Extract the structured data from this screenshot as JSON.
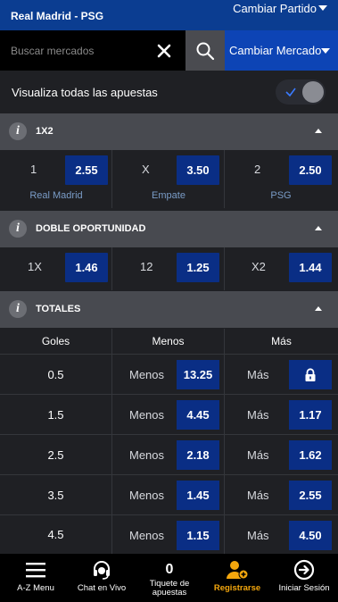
{
  "header": {
    "match_title": "Real Madrid - PSG",
    "change_match_label": "Cambiar Partido"
  },
  "search": {
    "placeholder": "Buscar mercados",
    "change_market_label": "Cambiar Mercado"
  },
  "toggle": {
    "label": "Visualiza todas las apuestas",
    "on": true
  },
  "market_1x2": {
    "title": "1X2",
    "outcomes": [
      {
        "label": "1",
        "odds": "2.55",
        "name": "Real Madrid"
      },
      {
        "label": "X",
        "odds": "3.50",
        "name": "Empate"
      },
      {
        "label": "2",
        "odds": "2.50",
        "name": "PSG"
      }
    ]
  },
  "market_double": {
    "title": "DOBLE OPORTUNIDAD",
    "outcomes": [
      {
        "label": "1X",
        "odds": "1.46"
      },
      {
        "label": "12",
        "odds": "1.25"
      },
      {
        "label": "X2",
        "odds": "1.44"
      }
    ]
  },
  "market_totals": {
    "title": "TOTALES",
    "columns": [
      "Goles",
      "Menos",
      "Más"
    ],
    "under_label": "Menos",
    "over_label": "Más",
    "rows": [
      {
        "goals": "0.5",
        "under": "13.25",
        "over": "",
        "over_locked": true
      },
      {
        "goals": "1.5",
        "under": "4.45",
        "over": "1.17"
      },
      {
        "goals": "2.5",
        "under": "2.18",
        "over": "1.62"
      },
      {
        "goals": "3.5",
        "under": "1.45",
        "over": "2.55"
      },
      {
        "goals": "4.5",
        "under": "1.15",
        "over": "4.50"
      }
    ]
  },
  "nav": {
    "items": [
      {
        "label": "A-Z Menu",
        "icon": "menu-icon"
      },
      {
        "label": "Chat en Vivo",
        "icon": "headset-icon"
      },
      {
        "label": "Tiquete de apuestas",
        "icon": "ticket-count",
        "count": "0"
      },
      {
        "label": "Registrarse",
        "icon": "add-user-icon"
      },
      {
        "label": "Iniciar Sesión",
        "icon": "login-arrow-icon"
      }
    ]
  },
  "colors": {
    "header_blue": "#0b3d91",
    "market_blue": "#0d44b5",
    "odds_blue": "#0a2e85",
    "accent": "#f4a70d"
  }
}
